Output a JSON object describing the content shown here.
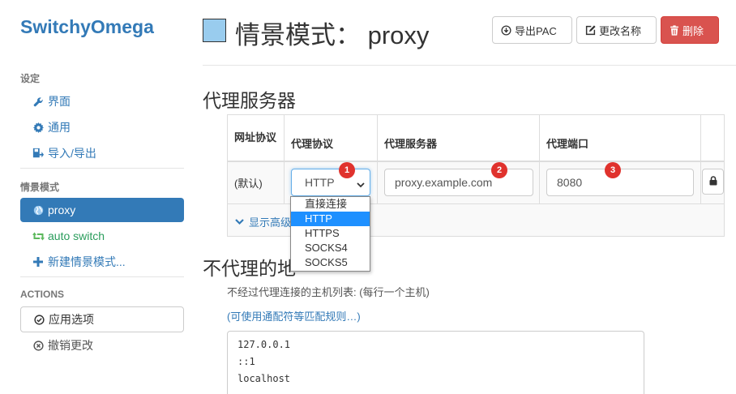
{
  "brand": "SwitchyOmega",
  "sidebar": {
    "settings_header": "设定",
    "settings_items": [
      {
        "label": "界面",
        "icon": "wrench-icon"
      },
      {
        "label": "通用",
        "icon": "gear-icon"
      },
      {
        "label": "导入/导出",
        "icon": "import-export-icon"
      }
    ],
    "profiles_header": "情景模式",
    "profile_items": [
      {
        "label": "proxy",
        "icon": "globe-icon",
        "active": true
      },
      {
        "label": "auto switch",
        "icon": "retweet-icon",
        "active": false
      },
      {
        "label": "新建情景模式...",
        "icon": "plus-icon",
        "active": false
      }
    ],
    "actions_header": "ACTIONS",
    "apply_label": "应用选项",
    "discard_label": "撤销更改"
  },
  "header": {
    "title": "情景模式： proxy",
    "swatch_color": "#99ccee",
    "export_pac_label": "导出PAC",
    "rename_label": "更改名称",
    "delete_label": "删除"
  },
  "proxy_servers": {
    "title": "代理服务器",
    "columns": [
      "网址协议",
      "代理协议",
      "代理服务器",
      "代理端口"
    ],
    "row": {
      "scheme": "(默认)",
      "protocol": "HTTP",
      "server": "proxy.example.com",
      "port": "8080"
    },
    "badges": [
      "1",
      "2",
      "3"
    ],
    "show_advanced": "显示高级",
    "protocol_options": [
      "直接连接",
      "HTTP",
      "HTTPS",
      "SOCKS4",
      "SOCKS5"
    ],
    "selected_option": "HTTP"
  },
  "bypass": {
    "title_partial": "不代理的地",
    "description": "不经过代理连接的主机列表: (每行一个主机)",
    "wildcard_link": "(可使用通配符等匹配规则…)",
    "lines": [
      "127.0.0.1",
      "::1",
      "localhost"
    ]
  },
  "colors": {
    "primary": "#337ab7",
    "danger": "#d9534f",
    "badge": "#e0322d",
    "green": "#2a9d5c"
  }
}
